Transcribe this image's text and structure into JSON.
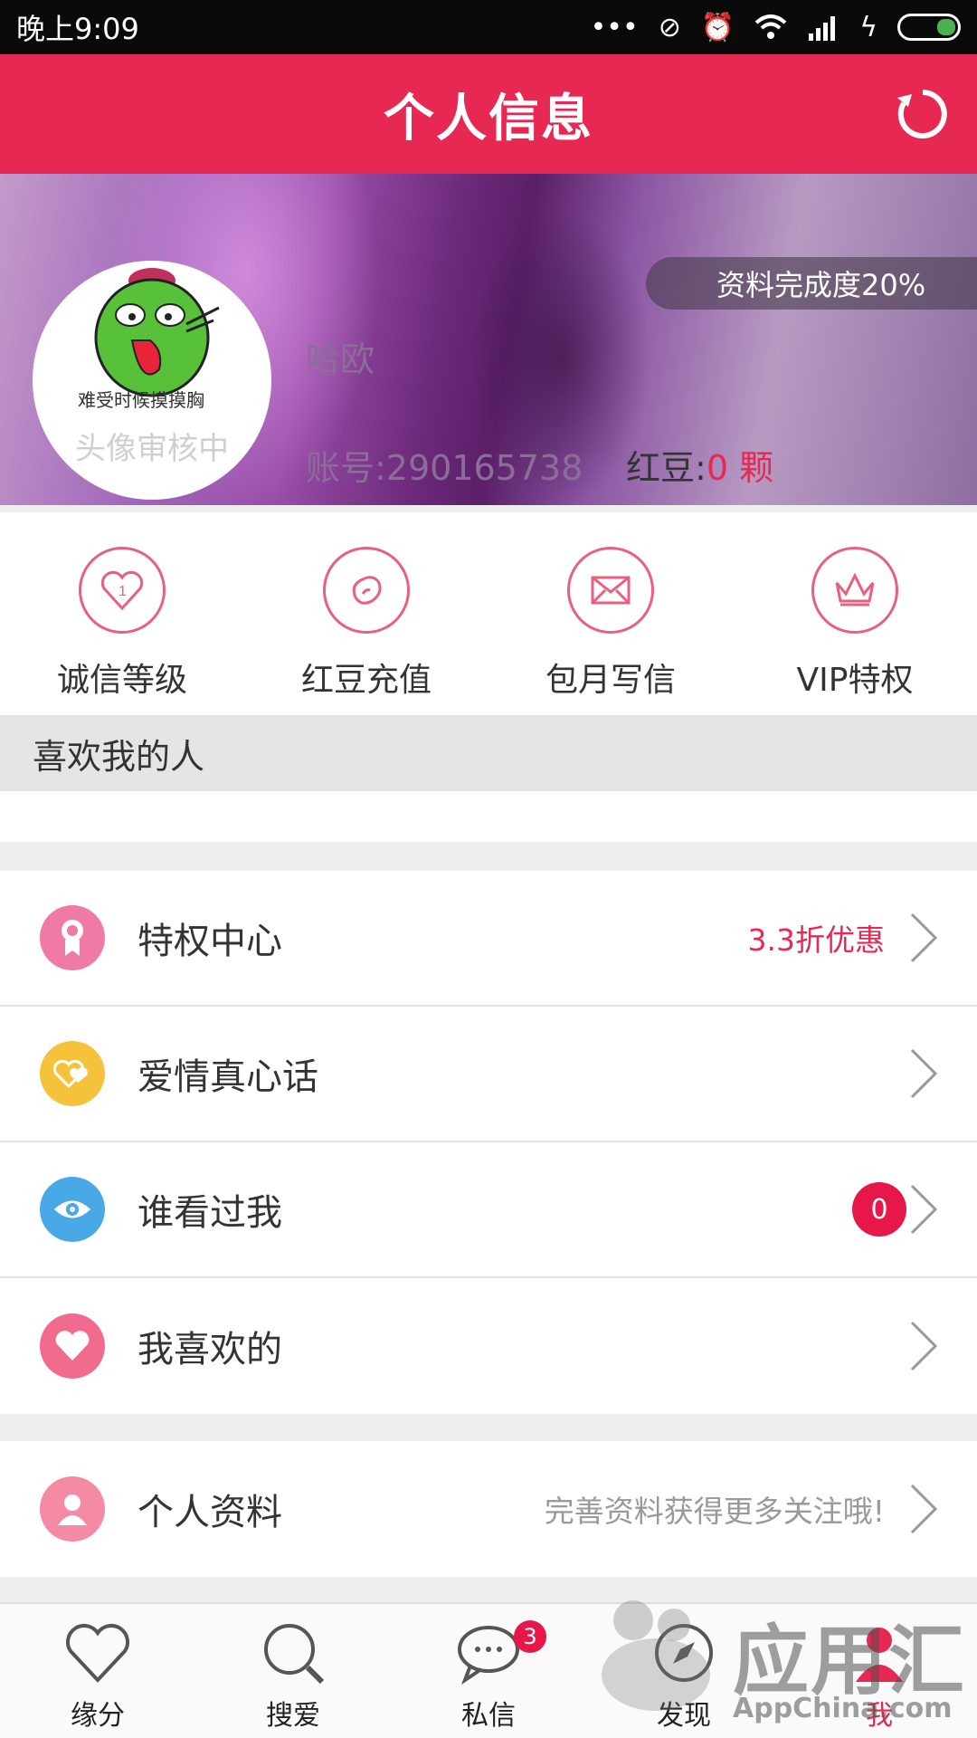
{
  "status_bar": {
    "time": "晚上9:09",
    "icons": [
      "more-icon",
      "mute-icon",
      "alarm-icon",
      "wifi-icon",
      "signal-icon",
      "charging-icon",
      "battery-icon"
    ]
  },
  "header": {
    "title": "个人信息",
    "refresh_icon": "refresh-icon"
  },
  "profile": {
    "completion": "资料完成度20%",
    "avatar_caption": "难受时候摸摸胸",
    "avatar_status": "头像审核中",
    "nickname": "哈欧",
    "account": "账号:290165738",
    "beans_label": "红豆:",
    "beans_value": "0 颗"
  },
  "quick_actions": [
    {
      "label": "诚信等级",
      "icon": "heart-badge-icon"
    },
    {
      "label": "红豆充值",
      "icon": "bean-icon"
    },
    {
      "label": "包月写信",
      "icon": "envelope-icon"
    },
    {
      "label": "VIP特权",
      "icon": "crown-icon"
    }
  ],
  "likes_section": {
    "title": "喜欢我的人"
  },
  "menu_group_1": [
    {
      "label": "特权中心",
      "right_text": "3.3折优惠",
      "icon": "award-icon",
      "icon_color": "#f07aa6"
    },
    {
      "label": "爱情真心话",
      "right_text": "",
      "icon": "love-hearts-icon",
      "icon_color": "#f5c33b"
    },
    {
      "label": "谁看过我",
      "badge": "0",
      "icon": "eye-icon",
      "icon_color": "#48a9e6"
    },
    {
      "label": "我喜欢的",
      "right_text": "",
      "icon": "heart-icon",
      "icon_color": "#f06b8e"
    }
  ],
  "menu_group_2": [
    {
      "label": "个人资料",
      "right_text": "完善资料获得更多关注哦!",
      "icon": "person-icon",
      "icon_color": "#f58aa5"
    }
  ],
  "tab_bar": [
    {
      "label": "缘分",
      "icon": "heart-outline-icon"
    },
    {
      "label": "搜爱",
      "icon": "search-icon"
    },
    {
      "label": "私信",
      "icon": "chat-icon",
      "badge": "3"
    },
    {
      "label": "发现",
      "icon": "compass-icon"
    },
    {
      "label": "我",
      "icon": "profile-icon",
      "active": true
    }
  ],
  "watermark": {
    "title": "应用汇",
    "subtitle": "AppChina.com"
  },
  "colors": {
    "brand": "#e62852",
    "accent_text": "#e62852"
  }
}
